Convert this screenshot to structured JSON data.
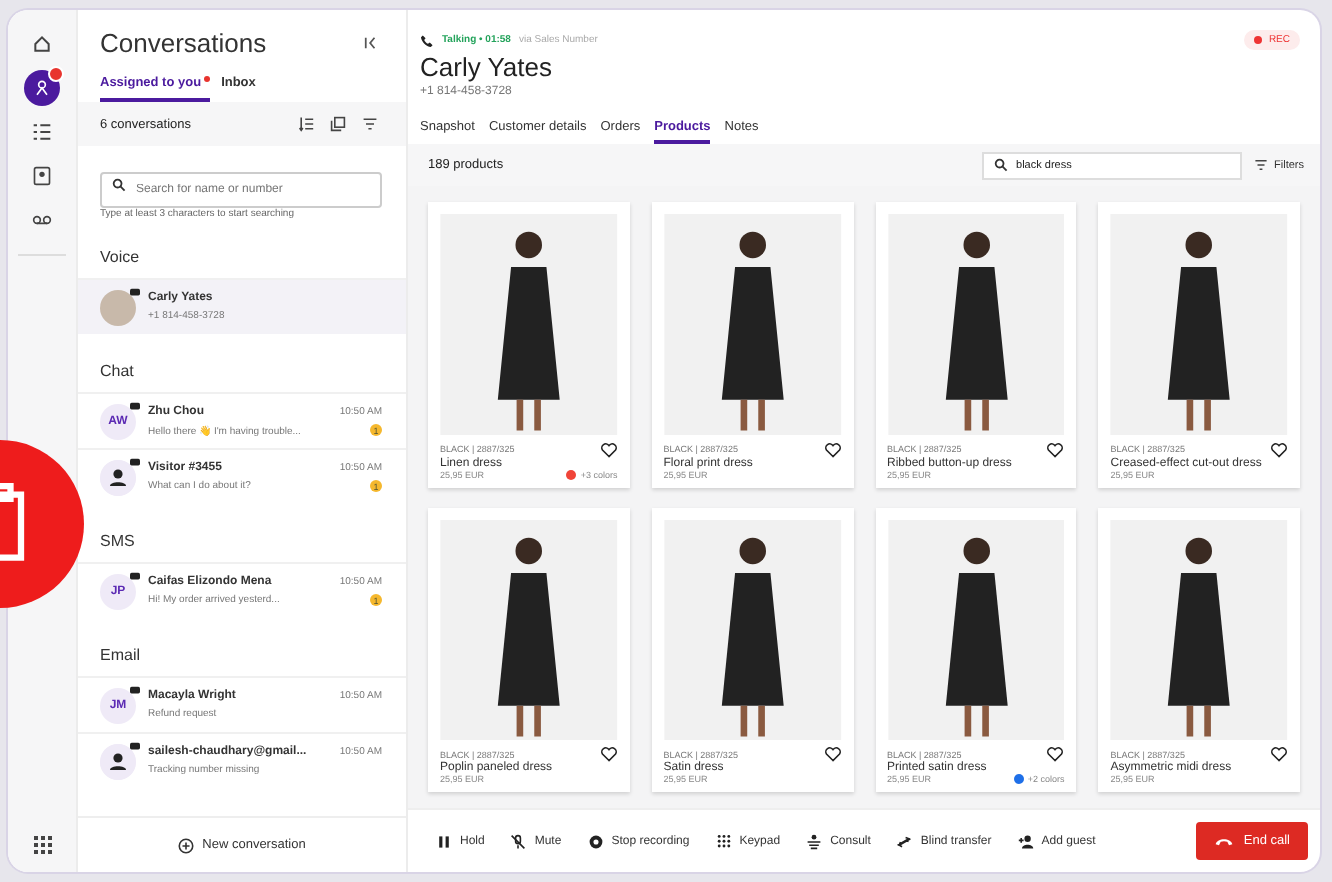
{
  "rail": {
    "items": [
      {
        "kind": "home",
        "selected": false,
        "badge": false
      },
      {
        "kind": "agent",
        "selected": true,
        "badge": true
      },
      {
        "kind": "list",
        "selected": false,
        "badge": false
      },
      {
        "kind": "contacts",
        "selected": false,
        "badge": false
      },
      {
        "kind": "voicemail",
        "selected": false,
        "badge": false
      }
    ]
  },
  "conversations": {
    "title": "Conversations",
    "tabs": [
      {
        "label": "Assigned to you",
        "selected": true,
        "dot": true
      },
      {
        "label": "Inbox",
        "selected": false,
        "dot": false
      }
    ],
    "count": "6 conversations",
    "search": {
      "placeholder": "Search for name or number"
    },
    "hint": "Type at least 3 characters to start searching",
    "sections": [
      {
        "title": "Voice",
        "items": [
          {
            "kind": "photo",
            "name": "Carly Yates",
            "preview": "+1 814-458-3728",
            "selected": true
          }
        ]
      },
      {
        "title": "Chat",
        "items": [
          {
            "kind": "initials",
            "name": "Zhu Chou",
            "preview": "Hello there 👋 I'm having trouble...",
            "time": "10:50 AM",
            "unread": "1",
            "initials": "AW",
            "selected": false
          },
          {
            "kind": "person",
            "name": "Visitor #3455",
            "preview": "What can I do about it?",
            "time": "10:50 AM",
            "unread": "1",
            "selected": false
          }
        ]
      },
      {
        "title": "SMS",
        "items": [
          {
            "kind": "initials",
            "name": "Caifas Elizondo Mena",
            "preview": "Hi! My order arrived yesterd...",
            "time": "10:50 AM",
            "unread": "1",
            "initials": "JP",
            "selected": false
          }
        ]
      },
      {
        "title": "Email",
        "items": [
          {
            "kind": "initials",
            "name": "Macayla Wright",
            "preview": "Refund request",
            "time": "10:50 AM",
            "initials": "JM",
            "selected": false
          },
          {
            "kind": "person",
            "name": "sailesh-chaudhary@gmail...",
            "preview": "Tracking number missing",
            "time": "10:50 AM",
            "selected": false
          }
        ]
      }
    ],
    "new_conversation": "New conversation"
  },
  "call": {
    "status": "Talking • 01:58",
    "via": "via Sales Number",
    "name": "Carly Yates",
    "phone": "+1 814-458-3728",
    "rec": "REC"
  },
  "tabs": [
    {
      "label": "Snapshot",
      "selected": false
    },
    {
      "label": "Customer details",
      "selected": false
    },
    {
      "label": "Orders",
      "selected": false
    },
    {
      "label": "Products",
      "selected": true
    },
    {
      "label": "Notes",
      "selected": false
    }
  ],
  "products_bar": {
    "count": "189 products",
    "search": "black dress",
    "filters": "Filters"
  },
  "products": [
    {
      "sku": "BLACK | 2887/325",
      "name": "Linen dress",
      "price": "25,95 EUR",
      "colors": "+3 colors",
      "color": "#f04438"
    },
    {
      "sku": "BLACK | 2887/325",
      "name": "Floral print dress",
      "price": "25,95 EUR"
    },
    {
      "sku": "BLACK | 2887/325",
      "name": "Ribbed button-up dress",
      "price": "25,95 EUR"
    },
    {
      "sku": "BLACK | 2887/325",
      "name": "Creased-effect cut-out dress",
      "price": "25,95 EUR"
    },
    {
      "sku": "BLACK | 2887/325",
      "name": "Poplin paneled dress",
      "price": "25,95 EUR"
    },
    {
      "sku": "BLACK | 2887/325",
      "name": "Satin dress",
      "price": "25,95 EUR"
    },
    {
      "sku": "BLACK | 2887/325",
      "name": "Printed satin dress",
      "price": "25,95 EUR",
      "colors": "+2 colors",
      "color": "#1e6fe8"
    },
    {
      "sku": "BLACK | 2887/325",
      "name": "Asymmetric midi dress",
      "price": "25,95 EUR"
    }
  ],
  "actions": [
    {
      "label": "Hold",
      "kind": "hold"
    },
    {
      "label": "Mute",
      "kind": "mute"
    },
    {
      "label": "Stop recording",
      "kind": "record"
    },
    {
      "label": "Keypad",
      "kind": "keypad"
    },
    {
      "label": "Consult",
      "kind": "consult"
    },
    {
      "label": "Blind transfer",
      "kind": "transfer"
    },
    {
      "label": "Add guest",
      "kind": "guest"
    }
  ],
  "end_call": "End call"
}
